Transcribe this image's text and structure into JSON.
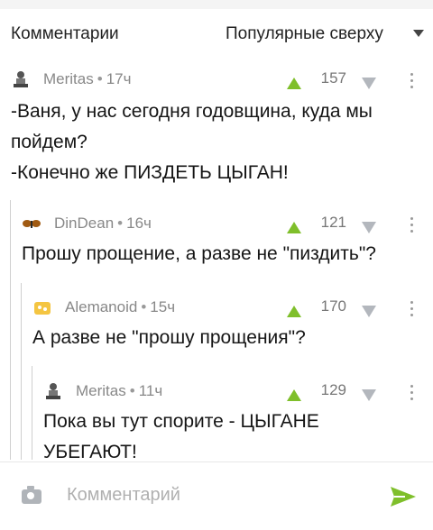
{
  "header": {
    "title": "Комментарии",
    "sort_label": "Популярные сверху"
  },
  "comments": [
    {
      "author": "Meritas",
      "time": "17ч",
      "score": "157",
      "lines": [
        "-Ваня, у нас сегодня годовщина, куда мы",
        "пойдем?",
        "-Конечно же ПИЗДЕТЬ ЦЫГАН!"
      ]
    },
    {
      "author": "DinDean",
      "time": "16ч",
      "score": "121",
      "lines": [
        "Прошу прощение, а разве не \"пиздить\"?"
      ]
    },
    {
      "author": "Alemanoid",
      "time": "15ч",
      "score": "170",
      "lines": [
        "А разве не \"прошу прощения\"?"
      ]
    },
    {
      "author": "Meritas",
      "time": "11ч",
      "score": "129",
      "lines": [
        "Пока вы тут спорите - ЦЫГАНЕ",
        "УБЕГАЮТ!"
      ]
    }
  ],
  "footer": {
    "placeholder": "Комментарий"
  },
  "colors": {
    "upvote": "#7fbf2b",
    "downvote": "#b3b7bd",
    "send": "#7fbf2b"
  },
  "icons": {
    "camera": "camera-icon",
    "send": "send-icon",
    "upvote": "upvote-icon",
    "downvote": "downvote-icon",
    "more": "more-icon"
  }
}
